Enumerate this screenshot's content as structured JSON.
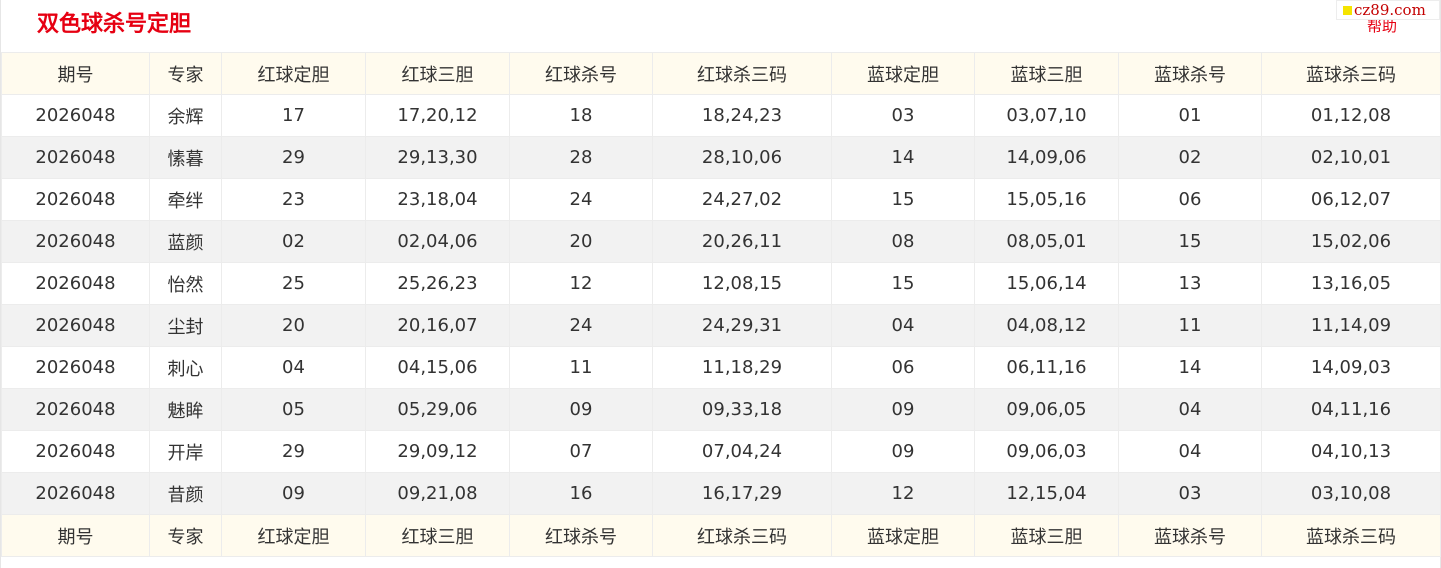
{
  "header": {
    "title": "双色球杀号定胆",
    "help_label": "帮助",
    "watermark": "cz89.com"
  },
  "colors": {
    "title": "#e60012",
    "header_bg": "#fffbee",
    "row_alt_bg": "#f2f2f2"
  },
  "table": {
    "columns": [
      "期号",
      "专家",
      "红球定胆",
      "红球三胆",
      "红球杀号",
      "红球杀三码",
      "蓝球定胆",
      "蓝球三胆",
      "蓝球杀号",
      "蓝球杀三码"
    ],
    "rows": [
      [
        "2026048",
        "余辉",
        "17",
        "17,20,12",
        "18",
        "18,24,23",
        "03",
        "03,07,10",
        "01",
        "01,12,08"
      ],
      [
        "2026048",
        "愫暮",
        "29",
        "29,13,30",
        "28",
        "28,10,06",
        "14",
        "14,09,06",
        "02",
        "02,10,01"
      ],
      [
        "2026048",
        "牵绊",
        "23",
        "23,18,04",
        "24",
        "24,27,02",
        "15",
        "15,05,16",
        "06",
        "06,12,07"
      ],
      [
        "2026048",
        "蓝颜",
        "02",
        "02,04,06",
        "20",
        "20,26,11",
        "08",
        "08,05,01",
        "15",
        "15,02,06"
      ],
      [
        "2026048",
        "怡然",
        "25",
        "25,26,23",
        "12",
        "12,08,15",
        "15",
        "15,06,14",
        "13",
        "13,16,05"
      ],
      [
        "2026048",
        "尘封",
        "20",
        "20,16,07",
        "24",
        "24,29,31",
        "04",
        "04,08,12",
        "11",
        "11,14,09"
      ],
      [
        "2026048",
        "刺心",
        "04",
        "04,15,06",
        "11",
        "11,18,29",
        "06",
        "06,11,16",
        "14",
        "14,09,03"
      ],
      [
        "2026048",
        "魅眸",
        "05",
        "05,29,06",
        "09",
        "09,33,18",
        "09",
        "09,06,05",
        "04",
        "04,11,16"
      ],
      [
        "2026048",
        "开岸",
        "29",
        "29,09,12",
        "07",
        "07,04,24",
        "09",
        "09,06,03",
        "04",
        "04,10,13"
      ],
      [
        "2026048",
        "昔颜",
        "09",
        "09,21,08",
        "16",
        "16,17,29",
        "12",
        "12,15,04",
        "03",
        "03,10,08"
      ]
    ]
  }
}
